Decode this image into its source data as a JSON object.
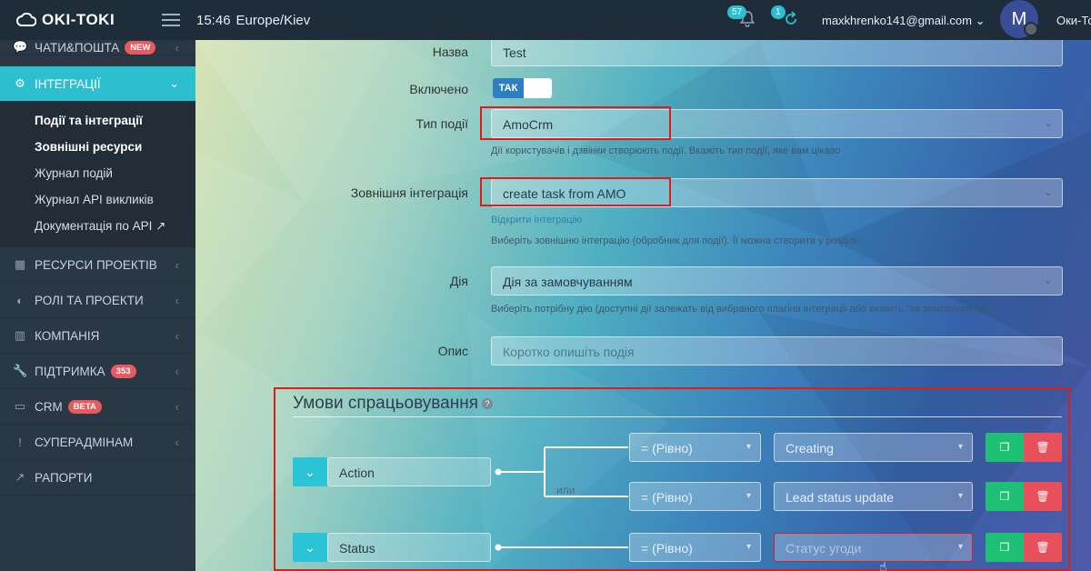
{
  "topbar": {
    "logo_text": "OKI-TOKI",
    "time": "15:46",
    "timezone": "Europe/Kiev",
    "notifications_count": "57",
    "tasks_count": "1",
    "user_email": "maxkhrenko141@gmail.com",
    "avatar_letter": "M",
    "org_name": "Оки-То"
  },
  "sidebar": {
    "items": [
      {
        "label": "ЧАТИ&ПОШТА",
        "icon": "chat-icon",
        "badge": "NEW"
      },
      {
        "label": "ІНТЕГРАЦІЇ",
        "icon": "cogs-icon",
        "active": true
      },
      {
        "label": "РЕСУРСИ ПРОЕКТІВ",
        "icon": "grid-icon"
      },
      {
        "label": "РОЛІ ТА ПРОЕКТИ",
        "icon": "toggle-icon"
      },
      {
        "label": "КОМПАНІЯ",
        "icon": "bar-chart-icon"
      },
      {
        "label": "ПІДТРИМКА",
        "icon": "wrench-icon",
        "badge": "353"
      },
      {
        "label": "CRM",
        "icon": "card-icon",
        "badge": "BETA"
      },
      {
        "label": "СУПЕРАДМІНАМ",
        "icon": "exclamation-icon"
      },
      {
        "label": "РАПОРТИ",
        "icon": "line-chart-icon"
      }
    ],
    "sub_items": [
      {
        "label": "Події та інтеграції",
        "bold": true
      },
      {
        "label": "Зовнішні ресурси",
        "bold": true
      },
      {
        "label": "Журнал подій"
      },
      {
        "label": "Журнал API викликів"
      },
      {
        "label": "Документація по API"
      }
    ]
  },
  "form": {
    "name_label": "Назва",
    "name_value": "Test",
    "enabled_label": "Включено",
    "enabled_value": "ТАК",
    "event_type_label": "Тип події",
    "event_type_value": "AmoCrm",
    "event_type_hint": "Дії користувачів і дзвінки створюють події. Вкажіть тип події, яке вам цікаво",
    "integration_label": "Зовнішня інтеграція",
    "integration_value": "create task from AMO",
    "integration_link": "Відкрити інтеграцію",
    "integration_hint": "Виберіть зовнішню інтеграцію (обробник для події). Її можна створити у розділі",
    "action_label": "Дія",
    "action_value": "Дія за замовчуванням",
    "action_hint": "Виберіть потрібну дію (доступні дії залежать від вибраного плагіна інтеграції або вкажіть \"за замовчуванням\"",
    "description_label": "Опис",
    "description_placeholder": "Коротко опишіть подія"
  },
  "conditions": {
    "title": "Умови спрацьовування",
    "or_label": "или",
    "rows": [
      {
        "field": "Action",
        "operator": "= (Рівно)",
        "value": "Creating"
      },
      {
        "operator": "= (Рівно)",
        "value": "Lead status update"
      },
      {
        "field": "Status",
        "operator": "= (Рівно)",
        "value": "Статус угоди"
      }
    ]
  },
  "colors": {
    "accent": "#2bbfcf",
    "highlight_box": "#e11a1a",
    "copy_button": "#1fbf75",
    "delete_button": "#e8505b"
  }
}
